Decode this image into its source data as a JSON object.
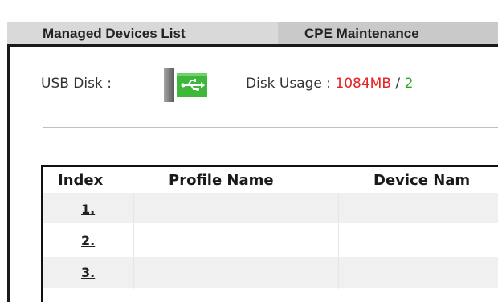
{
  "tabs": [
    {
      "label": "Managed Devices List"
    },
    {
      "label": "CPE Maintenance"
    }
  ],
  "usb": {
    "label": "USB Disk :",
    "icon": "usb-connected-icon"
  },
  "disk": {
    "label": "Disk Usage : ",
    "used": "1084MB",
    "separator": " / ",
    "total_visible": "2"
  },
  "table": {
    "headers": [
      "Index",
      "Profile Name",
      "Device Nam"
    ],
    "rows": [
      {
        "index": "1.",
        "profile": "",
        "device": ""
      },
      {
        "index": "2.",
        "profile": "",
        "device": ""
      },
      {
        "index": "3.",
        "profile": "",
        "device": ""
      }
    ]
  },
  "colors": {
    "used": "#e8201f",
    "total": "#2aa82a",
    "usb_green": "#3db83b"
  }
}
